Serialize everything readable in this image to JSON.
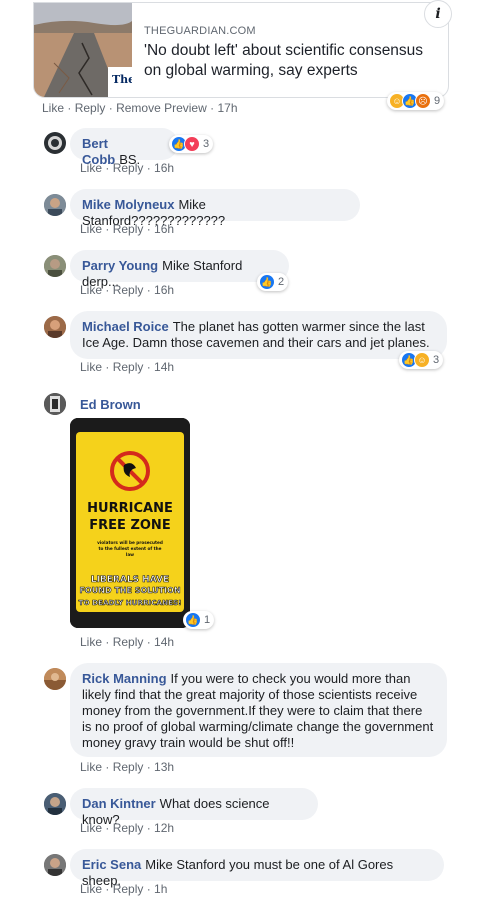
{
  "preview": {
    "source": "THEGUARDIAN.COM",
    "title": "'No doubt left' about scientific consensus on global warming, say experts",
    "thumb_text": "The Gua",
    "info_glyph": "i",
    "reaction_count": "9"
  },
  "post_actions": {
    "like": "Like",
    "reply": "Reply",
    "remove_preview": "Remove Preview",
    "time": "17h",
    "sep": "·"
  },
  "comments": [
    {
      "name": "Bert Cobb",
      "text": "BS.",
      "like": "Like",
      "reply": "Reply",
      "time": "16h",
      "reactions": "3"
    },
    {
      "name": "Mike Molyneux",
      "text": "Mike Stanford?????????????",
      "like": "Like",
      "reply": "Reply",
      "time": "16h"
    },
    {
      "name": "Parry Young",
      "text": "Mike Stanford derp...",
      "like": "Like",
      "reply": "Reply",
      "time": "16h",
      "reactions": "2"
    },
    {
      "name": "Michael Roice",
      "text": "The planet has gotten warmer since the last Ice Age. Damn those cavemen and their cars and jet planes.",
      "like": "Like",
      "reply": "Reply",
      "time": "14h",
      "reactions": "3"
    },
    {
      "name": "Ed Brown",
      "like": "Like",
      "reply": "Reply",
      "time": "14h",
      "reactions": "1"
    },
    {
      "name": "Rick Manning",
      "text": "If you were to check you would more than likely find that the great majority of those scientists receive money from the government.If they were to claim that there is no proof of global warming/climate change the government money gravy train would be shut off!!",
      "like": "Like",
      "reply": "Reply",
      "time": "13h"
    },
    {
      "name": "Dan Kintner",
      "text": "What does science know?",
      "like": "Like",
      "reply": "Reply",
      "time": "12h"
    },
    {
      "name": "Eric Sena",
      "text": "Mike Stanford you must be one of Al Gores sheep.",
      "like": "Like",
      "reply": "Reply",
      "time": "1h"
    }
  ],
  "sign": {
    "line1": "HURRICANE",
    "line2": "FREE ZONE",
    "fine1": "violators will be prosecuted",
    "fine2": "to the fullest extent of the",
    "fine3": "law",
    "bottom1": "LIBERALS HAVE",
    "bottom2": "FOUND THE SOLUTION",
    "bottom3": "TO DEADLY HURRICANES!"
  },
  "colors": {
    "name_blue": "#385898",
    "bubble_bg": "#f0f2f5",
    "meta_gray": "#606770",
    "like_blue": "#1877f2",
    "sign_yellow": "#f5d21b"
  }
}
